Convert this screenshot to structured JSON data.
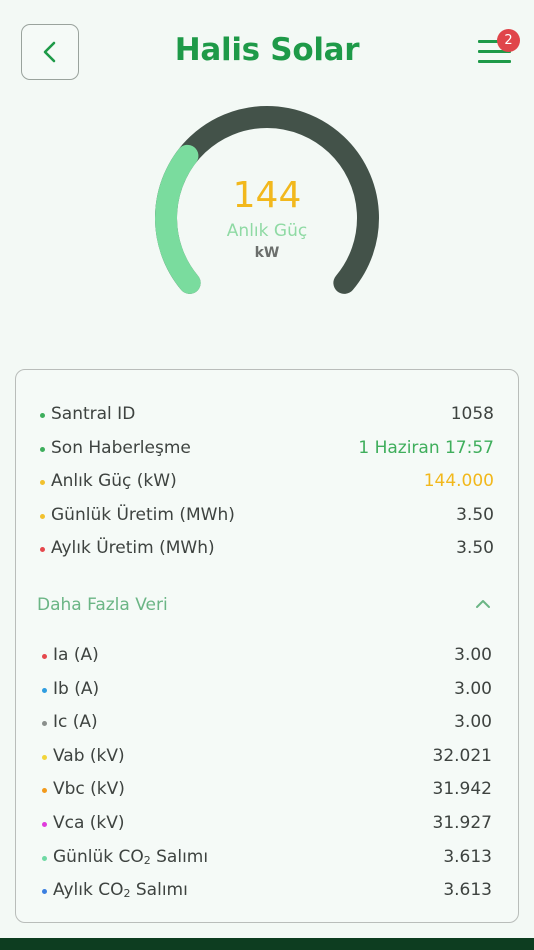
{
  "header": {
    "title": "Halis Solar",
    "notification_count": "2",
    "accent_color": "#1e9a48"
  },
  "gauge": {
    "value": "144",
    "label": "Anlık Güç",
    "unit": "kW",
    "fill_fraction": 0.3,
    "track_color": "#435249",
    "fill_color": "#7adc9e"
  },
  "summary": [
    {
      "label": "Santral ID",
      "value": "1058",
      "dot_color": "#3dae5c",
      "value_color": "#3e4340"
    },
    {
      "label": "Son Haberleşme",
      "value": "1 Haziran 17:57",
      "dot_color": "#3dae5c",
      "value_color": "#3fae5c"
    },
    {
      "label": "Anlık Güç (kW)",
      "value": "144.000",
      "dot_color": "#f2c12e",
      "value_color": "#f2b81c"
    },
    {
      "label": "Günlük Üretim (MWh)",
      "value": "3.50",
      "dot_color": "#f2c12e",
      "value_color": "#3e4340"
    },
    {
      "label": "Aylık Üretim (MWh)",
      "value": "3.50",
      "dot_color": "#e5484d",
      "value_color": "#3e4340"
    }
  ],
  "more": {
    "label": "Daha Fazla Veri"
  },
  "details": [
    {
      "label": "Ia (A)",
      "value": "3.00",
      "dot_color": "#e5484d"
    },
    {
      "label": "Ib (A)",
      "value": "3.00",
      "dot_color": "#2f9de0"
    },
    {
      "label": "Ic (A)",
      "value": "3.00",
      "dot_color": "#8a8f8c"
    },
    {
      "label": "Vab (kV)",
      "value": "32.021",
      "dot_color": "#f2d43a"
    },
    {
      "label": "Vbc (kV)",
      "value": "31.942",
      "dot_color": "#f29a1c"
    },
    {
      "label": "Vca (kV)",
      "value": "31.927",
      "dot_color": "#e03cdc"
    },
    {
      "label_pre": "Günlük CO",
      "label_sub": "2",
      "label_post": " Salımı",
      "value": "3.613",
      "dot_color": "#6fd9a4"
    },
    {
      "label_pre": "Aylık CO",
      "label_sub": "2",
      "label_post": " Salımı",
      "value": "3.613",
      "dot_color": "#3b7fe0"
    }
  ]
}
